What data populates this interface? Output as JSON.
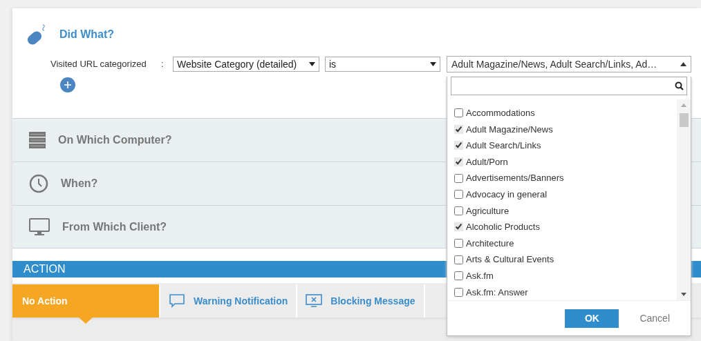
{
  "rule": {
    "title": "Did What?",
    "label": "Visited URL categorized",
    "separator": ":",
    "field": "Website Category (detailed)",
    "operator": "is",
    "value": "Adult Magazine/News, Adult Search/Links, Ad…"
  },
  "sections": [
    {
      "title": "On Which Computer?"
    },
    {
      "title": "When?"
    },
    {
      "title": "From Which Client?"
    }
  ],
  "action": {
    "title": "ACTION",
    "options": [
      {
        "label": "No Action",
        "selected": true
      },
      {
        "label": "Warning Notification",
        "selected": false
      },
      {
        "label": "Blocking Message",
        "selected": false
      }
    ]
  },
  "dropdown": {
    "items": [
      {
        "label": "Accommodations",
        "checked": false
      },
      {
        "label": "Adult Magazine/News",
        "checked": true
      },
      {
        "label": "Adult Search/Links",
        "checked": true
      },
      {
        "label": "Adult/Porn",
        "checked": true
      },
      {
        "label": "Advertisements/Banners",
        "checked": false
      },
      {
        "label": "Advocacy in general",
        "checked": false
      },
      {
        "label": "Agriculture",
        "checked": false
      },
      {
        "label": "Alcoholic Products",
        "checked": true
      },
      {
        "label": "Architecture",
        "checked": false
      },
      {
        "label": "Arts & Cultural Events",
        "checked": false
      },
      {
        "label": "Ask.fm",
        "checked": false
      },
      {
        "label": "Ask.fm: Answer",
        "checked": false
      }
    ],
    "buttons": [
      "OK",
      "Cancel"
    ]
  }
}
